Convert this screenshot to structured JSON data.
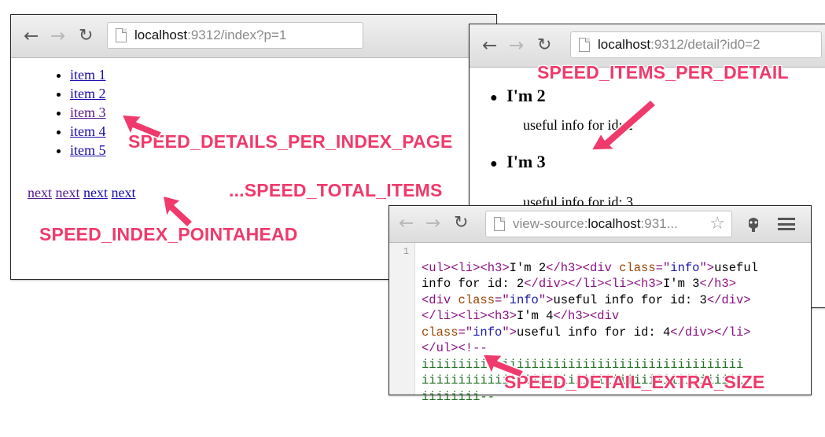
{
  "index_window": {
    "url_host": "localhost",
    "url_rest": ":9312/index?p=1",
    "items": [
      "item 1",
      "item 2",
      "item 3",
      "item 4",
      "item 5"
    ],
    "next_links": [
      "next",
      "next",
      "next",
      "next"
    ]
  },
  "detail_window": {
    "url_host": "localhost",
    "url_rest": ":9312/detail?id0=2",
    "heading_1": "I'm 2",
    "info_1": "useful info for id: 2",
    "heading_2": "I'm 3",
    "info_2": "useful info for id: 3"
  },
  "source_window": {
    "url_prefix": "view-source:",
    "url_host": "localhost",
    "url_rest": ":931...",
    "line_number": "1",
    "code": {
      "l1_a": "<ul><li><h3>",
      "l1_b": "I'm 2",
      "l1_c": "</h3><div ",
      "l1_d": "class",
      "l1_e": "=\"",
      "l1_f": "info",
      "l1_g": "\">",
      "l1_h": "useful",
      "l2_a": "info for id: 2",
      "l2_b": "</div></li><li><h3>",
      "l2_c": "I'm 3",
      "l2_d": "</h3>",
      "l3_a": "<div ",
      "l3_b": "class",
      "l3_c": "=\"",
      "l3_d": "info",
      "l3_e": "\">",
      "l3_f": "useful info for id: 3",
      "l3_g": "</div>",
      "l4_a": "</li><li><h3>",
      "l4_b": "I'm 4",
      "l4_c": "</h3><div",
      "l5_a": "class",
      "l5_b": "=\"",
      "l5_c": "info",
      "l5_d": "\">",
      "l5_e": "useful info for id: 4",
      "l5_f": "</div></li>",
      "l6_a": "</ul><!--",
      "l7": "iiiiiiiiiiiiiiiiiiiiiiiiiiiiiiiiiiiiiiiiiiii",
      "l8": "iiiiiiiiiiiiiiiiiiiiiiiiiiiiiiiiiiiiiiiiiiii",
      "l9": "iiiiiiii--"
    }
  },
  "annotations": {
    "details_per_index_page": "SPEED_DETAILS_PER_INDEX_PAGE",
    "total_items": "...SPEED_TOTAL_ITEMS",
    "index_pointahead": "SPEED_INDEX_POINTAHEAD",
    "items_per_detail": "SPEED_ITEMS_PER_DETAIL",
    "detail_extra_size": "SPEED_DETAIL_EXTRA_SIZE"
  },
  "colors": {
    "annotation": "#ef3a6b",
    "link": "#1a0dab",
    "visited_link": "#551a8b",
    "source_tag": "#881280",
    "source_attr_name": "#994500",
    "source_attr_value": "#1a1aa6",
    "source_comment": "#236e25"
  },
  "icons": [
    "back-arrow-icon",
    "forward-arrow-icon",
    "reload-icon",
    "page-icon",
    "star-icon",
    "extension-icon",
    "menu-icon"
  ]
}
